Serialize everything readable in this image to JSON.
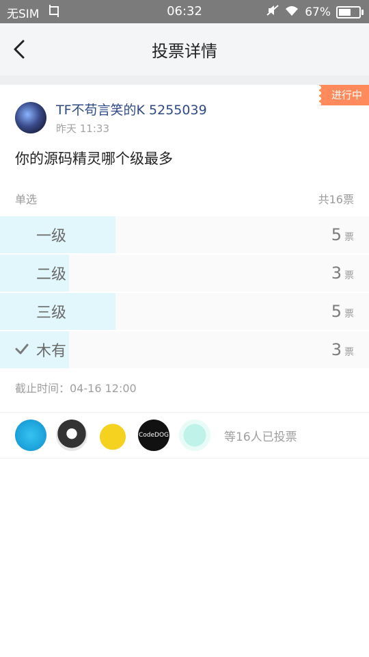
{
  "status_bar": {
    "carrier": "无SIM",
    "time": "06:32",
    "battery": "67%",
    "battery_level": 0.67
  },
  "header": {
    "title": "投票详情"
  },
  "post": {
    "status_badge": "进行中",
    "author": "TF不苟言笑的K 5255039",
    "time": "昨天 11:33",
    "question": "你的源码精灵哪个级最多",
    "vote_type": "单选",
    "total": "共16票"
  },
  "options": [
    {
      "label": "一级",
      "votes": "5",
      "unit": "票",
      "share": 0.3125,
      "selected": false
    },
    {
      "label": "二级",
      "votes": "3",
      "unit": "票",
      "share": 0.1875,
      "selected": false
    },
    {
      "label": "三级",
      "votes": "5",
      "unit": "票",
      "share": 0.3125,
      "selected": false
    },
    {
      "label": "木有",
      "votes": "3",
      "unit": "票",
      "share": 0.1875,
      "selected": true
    }
  ],
  "deadline": "截止时间：04-16 12:00",
  "voters": {
    "summary": "等16人已投票",
    "avatar4_text": "CodeDOG"
  },
  "colors": {
    "accent_blue": "#2e4a86",
    "badge_orange": "#ff8a5b",
    "bar_fill": "#e1f7fc"
  }
}
